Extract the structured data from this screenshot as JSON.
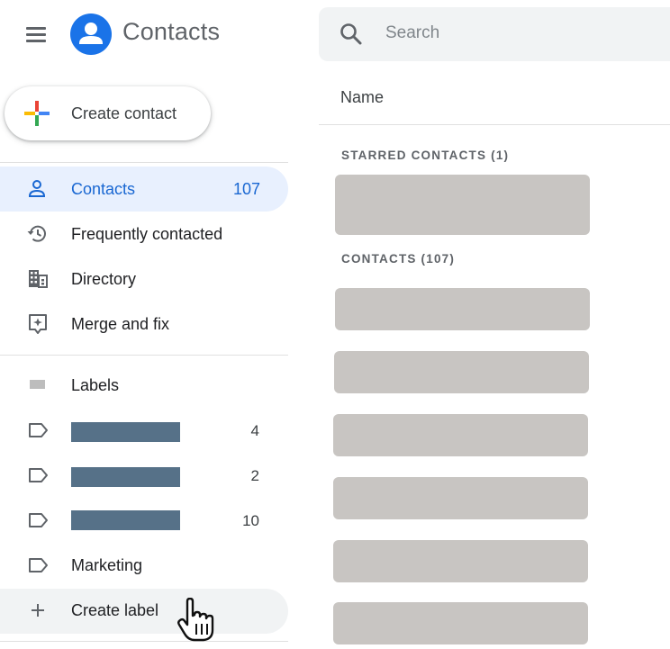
{
  "header": {
    "app_title": "Contacts",
    "search_placeholder": "Search",
    "icons": {
      "menu": "hamburger-menu-icon",
      "logo": "contacts-logo-icon",
      "search": "search-icon"
    }
  },
  "create_contact": {
    "label": "Create contact",
    "icon": "multicolor-plus-icon"
  },
  "nav": [
    {
      "label": "Contacts",
      "count": "107",
      "icon": "person-icon",
      "active": true
    },
    {
      "label": "Frequently contacted",
      "icon": "history-icon"
    },
    {
      "label": "Directory",
      "icon": "building-icon"
    },
    {
      "label": "Merge and fix",
      "icon": "merge-fix-icon"
    }
  ],
  "labels": {
    "heading": "Labels",
    "items": [
      {
        "label": "",
        "count": "4",
        "redacted": true
      },
      {
        "label": "",
        "count": "2",
        "redacted": true
      },
      {
        "label": "",
        "count": "10",
        "redacted": true
      },
      {
        "label": "Marketing",
        "count": ""
      }
    ],
    "create_label": "Create label"
  },
  "main": {
    "column_header": "Name",
    "starred_heading": "STARRED CONTACTS (1)",
    "contacts_heading": "CONTACTS (107)"
  },
  "colors": {
    "accent": "#1a73e8",
    "active_bg": "#e8f0fe",
    "active_text": "#1967d2",
    "redaction": "#567188",
    "placeholder_card": "#c8c5c2"
  }
}
